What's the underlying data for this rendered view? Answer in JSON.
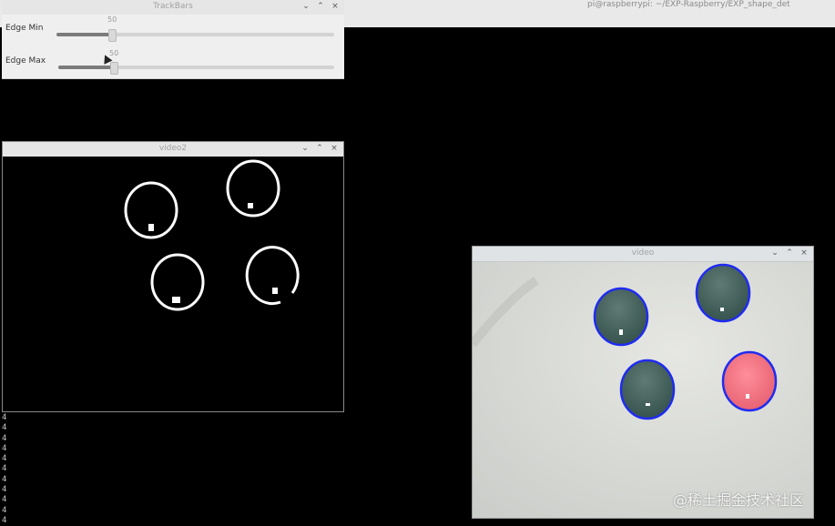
{
  "terminal": {
    "title": "pi@raspberrypi: ~/EXP-Raspberry/EXP_shape_det",
    "output_lines": [
      "4",
      "4",
      "4",
      "4",
      "4",
      "4",
      "4",
      "4",
      "4",
      "4",
      "4"
    ]
  },
  "trackbars_window": {
    "title": "TrackBars",
    "controls": {
      "minimize": "⌄",
      "maximize": "⌃",
      "close": "×"
    },
    "sliders": [
      {
        "label": "Edge Min",
        "value": "50",
        "level": 0.2
      },
      {
        "label": "Edge Max",
        "value": "50",
        "level": 0.2
      }
    ]
  },
  "video2_window": {
    "title": "video2",
    "controls": {
      "minimize": "⌄",
      "maximize": "⌃",
      "close": "×"
    }
  },
  "video_window": {
    "title": "video",
    "controls": {
      "minimize": "⌄",
      "maximize": "⌃",
      "close": "×"
    }
  },
  "colors": {
    "contour_blue": "#1f2cf0",
    "ball_dark": "#405e57",
    "ball_pink": "#ef7080",
    "paper": "#d8dad6"
  },
  "watermark": "@稀土掘金技术社区"
}
